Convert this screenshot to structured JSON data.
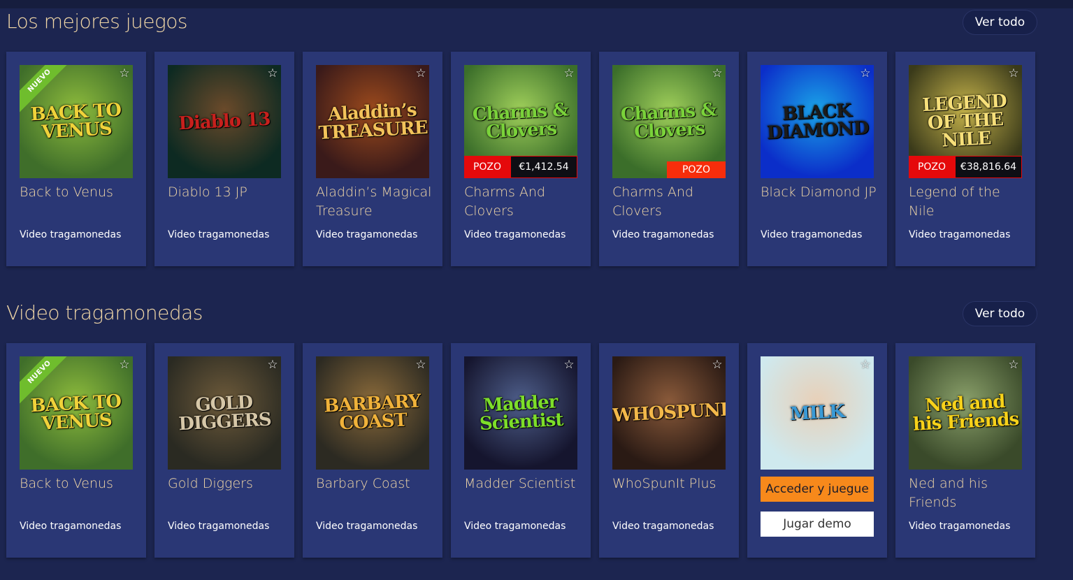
{
  "sections": [
    {
      "title": "Los mejores juegos",
      "view_all": "Ver todo",
      "cards": [
        {
          "name": "Back to Venus",
          "category": "Video tragamonedas",
          "logo": "BACK TO VENUS",
          "badge": "NUEVO",
          "jackpot_label": "",
          "jackpot_amount": "",
          "bg1": "#3f6e2a",
          "bg2": "#8dbb3c",
          "logo_color": "#f0d23a"
        },
        {
          "name": "Diablo 13 JP",
          "category": "Video tragamonedas",
          "logo": "Diablo 13",
          "badge": "",
          "jackpot_label": "",
          "jackpot_amount": "",
          "bg1": "#0d2a22",
          "bg2": "#6b4a2a",
          "logo_color": "#c7201d"
        },
        {
          "name": "Aladdin’s Magical Treasure",
          "category": "Video tragamonedas",
          "logo": "Aladdin’s TREASURE",
          "badge": "",
          "jackpot_label": "",
          "jackpot_amount": "",
          "bg1": "#3a1a1a",
          "bg2": "#9c4a1c",
          "logo_color": "#f3c35a"
        },
        {
          "name": "Charms And Clovers",
          "category": "Video tragamonedas",
          "logo": "Charms & Clovers",
          "badge": "",
          "jackpot_label": "POZO",
          "jackpot_amount": "€1,412.54",
          "bg1": "#3b6e2a",
          "bg2": "#9fcf5a",
          "logo_color": "#7ad23a"
        },
        {
          "name": "Charms And Clovers",
          "category": "Video tragamonedas",
          "logo": "Charms & Clovers",
          "badge": "",
          "jackpot_label": "POZO",
          "jackpot_amount": "",
          "bg1": "#3b6e2a",
          "bg2": "#9fcf5a",
          "logo_color": "#7ad23a"
        },
        {
          "name": "Black Diamond JP",
          "category": "Video tragamonedas",
          "logo": "BLACK DIAMOND",
          "badge": "",
          "jackpot_label": "",
          "jackpot_amount": "",
          "bg1": "#0b2ec9",
          "bg2": "#1aa3e8",
          "logo_color": "#1b1b1b"
        },
        {
          "name": "Legend of the Nile",
          "category": "Video tragamonedas",
          "logo": "LEGEND OF THE NILE",
          "badge": "",
          "jackpot_label": "POZO",
          "jackpot_amount": "€38,816.64",
          "bg1": "#3a3a1a",
          "bg2": "#c4b24a",
          "logo_color": "#f7e07a"
        }
      ]
    },
    {
      "title": "Video tragamonedas",
      "view_all": "Ver todo",
      "cards": [
        {
          "name": "Back to Venus",
          "category": "Video tragamonedas",
          "logo": "BACK TO VENUS",
          "badge": "NUEVO",
          "jackpot_label": "",
          "jackpot_amount": "",
          "bg1": "#3f6e2a",
          "bg2": "#8dbb3c",
          "logo_color": "#f0d23a"
        },
        {
          "name": "Gold Diggers",
          "category": "Video tragamonedas",
          "logo": "GOLD DIGGERS",
          "badge": "",
          "jackpot_label": "",
          "jackpot_amount": "",
          "bg1": "#2a2a22",
          "bg2": "#6d5a3a",
          "logo_color": "#d6c7a8"
        },
        {
          "name": "Barbary Coast",
          "category": "Video tragamonedas",
          "logo": "BARBARY COAST",
          "badge": "",
          "jackpot_label": "",
          "jackpot_amount": "",
          "bg1": "#2c2a22",
          "bg2": "#8a6a3a",
          "logo_color": "#f0b23a"
        },
        {
          "name": "Madder Scientist",
          "category": "Video tragamonedas",
          "logo": "Madder Scientist",
          "badge": "",
          "jackpot_label": "",
          "jackpot_amount": "",
          "bg1": "#15152e",
          "bg2": "#4e5e8a",
          "logo_color": "#7dde2a"
        },
        {
          "name": "WhoSpunIt Plus",
          "category": "Video tragamonedas",
          "logo": "WHOSPUNIT?",
          "badge": "",
          "jackpot_label": "",
          "jackpot_amount": "",
          "bg1": "#2a1a14",
          "bg2": "#8a5a3a",
          "logo_color": "#f3b84a"
        },
        {
          "name": "",
          "category": "",
          "logo": "MILK",
          "badge": "",
          "jackpot_label": "",
          "jackpot_amount": "",
          "bg1": "#cfe9ee",
          "bg2": "#e8d0b8",
          "logo_color": "#3a9ad6",
          "login_label": "Acceder y juegue",
          "demo_label": "Jugar demo"
        },
        {
          "name": "Ned and his Friends",
          "category": "Video tragamonedas",
          "logo": "Ned and his Friends",
          "badge": "",
          "jackpot_label": "",
          "jackpot_amount": "",
          "bg1": "#3a4a2a",
          "bg2": "#8aa06a",
          "logo_color": "#f7d21a"
        }
      ]
    }
  ],
  "colors": {
    "background": "#1c2550",
    "card": "#2a3775",
    "title": "#f3d9a8",
    "jackpot_red": "#e5090b",
    "login_orange": "#f7891b"
  }
}
